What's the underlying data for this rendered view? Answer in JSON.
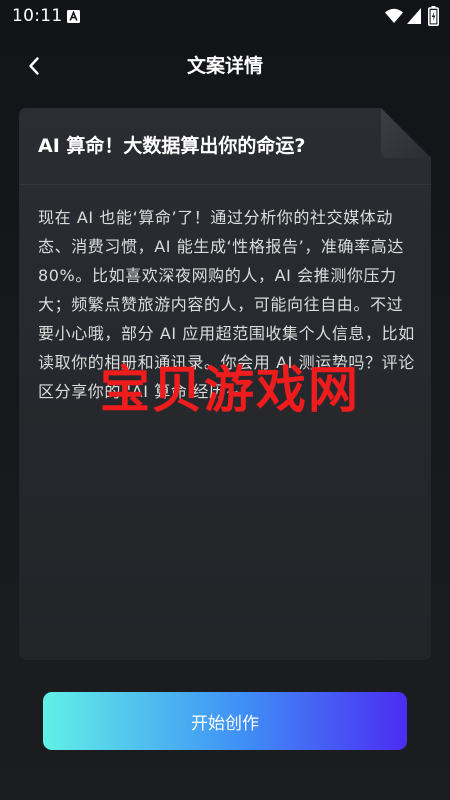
{
  "status_bar": {
    "time": "10:11",
    "icons": [
      "a-notification-icon",
      "wifi-icon",
      "signal-icon",
      "battery-icon"
    ]
  },
  "header": {
    "title": "文案详情",
    "back_icon": "chevron-left-icon"
  },
  "card": {
    "title": "AI 算命！大数据算出你的命运?",
    "body": "现在 AI 也能‘算命’了！通过分析你的社交媒体动态、消费习惯，AI 能生成‘性格报告’，准确率高达 80%。比如喜欢深夜网购的人，AI 会推测你压力大；频繁点赞旅游内容的人，可能向往自由。不过要小心哦，部分 AI 应用超范围收集个人信息，比如读取你的相册和通讯录。你会用 AI 测运势吗？评论区分享你的 'AI 算命'经历~"
  },
  "watermark": "宝贝游戏网",
  "primary_button": {
    "label": "开始创作"
  },
  "colors": {
    "background": "#15171b",
    "card": "#26292e",
    "watermark": "#ee1c1c",
    "button_gradient_start": "#61f0e6",
    "button_gradient_end": "#4c2cf2"
  }
}
